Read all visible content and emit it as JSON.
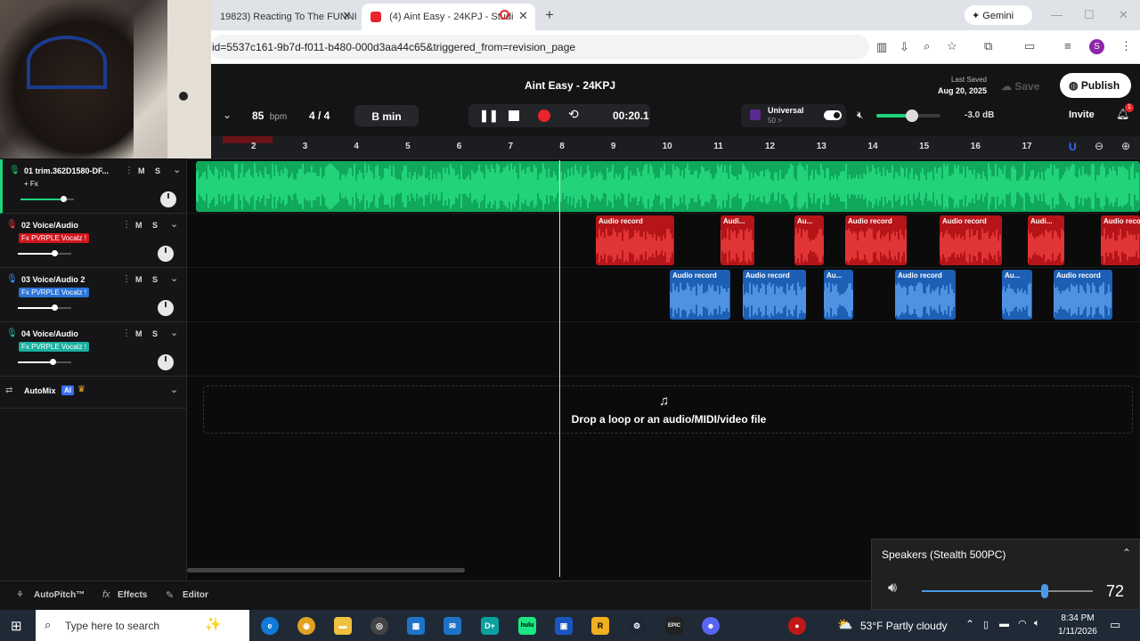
{
  "browser": {
    "tab1": "19823) Reacting To The FUNNI",
    "tab2": "(4) Aint Easy - 24KPJ - Studi",
    "gemini": "Gemini",
    "url": "id=5537c161-9b7d-f011-b480-000d3aa44c65&triggered_from=revision_page"
  },
  "app": {
    "title": "Aint Easy - 24KPJ",
    "bpm": "85",
    "bpm_unit": "bpm",
    "time_sig": "4 / 4",
    "key": "B min",
    "time": "00:20.1",
    "universal_label": "Universal",
    "universal_sub": "50 >",
    "db": "-3.0 dB",
    "master_volume": 0.55,
    "last_saved_label": "Last Saved",
    "last_saved_date": "Aug 20, 2025",
    "save": "Save",
    "publish": "Publish",
    "invite": "Invite",
    "notif_count": "1",
    "ruler_ticks": [
      "2",
      "3",
      "4",
      "5",
      "6",
      "7",
      "8",
      "9",
      "10",
      "11",
      "12",
      "13",
      "14",
      "15",
      "16",
      "17"
    ],
    "tracks": [
      {
        "name": "01  trim.362D1580-DF...",
        "fx": "+ Fx",
        "fx_style": "plain",
        "mic_color": "#20c060",
        "volume": 0.8
      },
      {
        "name": "02  Voice/Audio",
        "fx": "Fx PVRPLE Vocalz !",
        "fx_style": "red",
        "mic_color": "#ff4040",
        "volume": 0.68
      },
      {
        "name": "03  Voice/Audio 2",
        "fx": "Fx PVRPLE Vocalz !",
        "fx_style": "blue",
        "mic_color": "#3a9bff",
        "volume": 0.68
      },
      {
        "name": "04  Voice/Audio",
        "fx": "Fx PVRPLE Vocalz !",
        "fx_style": "teal",
        "mic_color": "#20c0a0",
        "volume": 0.65
      }
    ],
    "mute": "M",
    "solo": "S",
    "automix": "AutoMix",
    "ai_badge": "AI",
    "clips_red": [
      {
        "label": "Audio record"
      },
      {
        "label": "Audi..."
      },
      {
        "label": "Au..."
      },
      {
        "label": "Audio record"
      },
      {
        "label": "Audio record"
      },
      {
        "label": "Audi..."
      },
      {
        "label": "Audio record"
      }
    ],
    "clips_blue": [
      {
        "label": "Audio record"
      },
      {
        "label": "Audio record"
      },
      {
        "label": "Au..."
      },
      {
        "label": "Audio record"
      },
      {
        "label": "Au..."
      },
      {
        "label": "Audio record"
      }
    ],
    "drop_text": "Drop a loop or an audio/MIDI/video file",
    "bottom": {
      "autopitch": "AutoPitch™",
      "effects": "Effects",
      "editor": "Editor"
    }
  },
  "speakers": {
    "label": "Speakers (Stealth 500PC)",
    "volume": "72",
    "volume_fraction": 0.72
  },
  "taskbar": {
    "search_placeholder": "Type here to search",
    "weather": "53°F  Partly cloudy",
    "time": "8:34 PM",
    "date": "1/11/2026"
  },
  "colors": {
    "green_track": "#1ed47a",
    "red_clip": "#e02020",
    "blue_clip": "#2d7fe0",
    "record": "#e8252b"
  }
}
